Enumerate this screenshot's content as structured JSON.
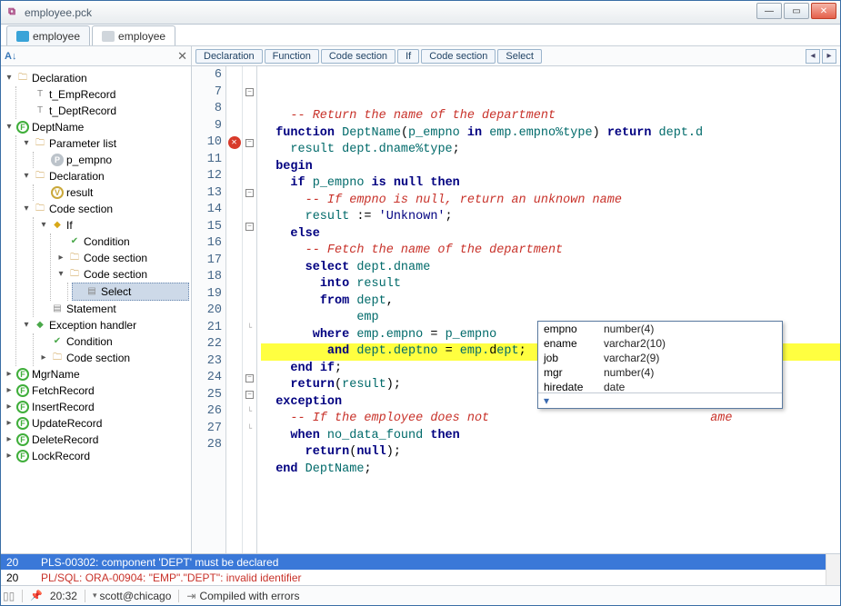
{
  "window": {
    "title": "employee.pck"
  },
  "file_tabs": [
    {
      "label": "employee",
      "active": false,
      "icon": "spec"
    },
    {
      "label": "employee",
      "active": true,
      "icon": "body"
    }
  ],
  "breadcrumbs": [
    "Declaration",
    "Function",
    "Code section",
    "If",
    "Code section",
    "Select"
  ],
  "tree": {
    "decl_label": "Declaration",
    "t_emp": "t_EmpRecord",
    "t_dept": "t_DeptRecord",
    "deptname": "DeptName",
    "paramlist": "Parameter list",
    "p_empno": "p_empno",
    "decl2": "Declaration",
    "result": "result",
    "codesec": "Code section",
    "if": "If",
    "condition": "Condition",
    "codesec2": "Code section",
    "codesec3": "Code section",
    "select": "Select",
    "statement": "Statement",
    "exhandler": "Exception handler",
    "condition2": "Condition",
    "codesec4": "Code section",
    "mgrname": "MgrName",
    "fetchrecord": "FetchRecord",
    "insertrecord": "InsertRecord",
    "updaterecord": "UpdateRecord",
    "deleterecord": "DeleteRecord",
    "lockrecord": "LockRecord"
  },
  "code": {
    "first_line": 6,
    "lines": [
      {
        "n": 6,
        "fold": "",
        "html": "    <span class='cmt'>-- Return the name of the department</span>"
      },
      {
        "n": 7,
        "fold": "box",
        "html": "  <span class='kw'>function</span> <span class='ident'>DeptName</span>(<span class='ident'>p_empno</span> <span class='kw'>in</span> <span class='ident'>emp.empno%type</span>) <span class='kw'>return</span> <span class='ident'>dept.d</span>"
      },
      {
        "n": 8,
        "fold": "",
        "html": "    <span class='ident'>result</span> <span class='ident'>dept.dname%type</span>;"
      },
      {
        "n": 9,
        "fold": "",
        "html": "  <span class='kw'>begin</span>"
      },
      {
        "n": 10,
        "fold": "box",
        "marker": "err",
        "html": "    <span class='kw'>if</span> <span class='ident'>p_empno</span> <span class='kw'>is</span> <span class='kw'>null</span> <span class='kw'>then</span>"
      },
      {
        "n": 11,
        "fold": "",
        "html": "      <span class='cmt'>-- If empno is null, return an unknown name</span>"
      },
      {
        "n": 12,
        "fold": "",
        "html": "      <span class='ident'>result</span> := <span class='str'>'Unknown'</span>;"
      },
      {
        "n": 13,
        "fold": "box",
        "html": "    <span class='kw'>else</span>"
      },
      {
        "n": 14,
        "fold": "",
        "html": "      <span class='cmt'>-- Fetch the name of the department</span>"
      },
      {
        "n": 15,
        "fold": "box",
        "html": "      <span class='kw'>select</span> <span class='ident'>dept.dname</span>"
      },
      {
        "n": 16,
        "fold": "",
        "html": "        <span class='kw'>into</span> <span class='ident'>result</span>"
      },
      {
        "n": 17,
        "fold": "",
        "html": "        <span class='kw'>from</span> <span class='ident'>dept</span>,"
      },
      {
        "n": 18,
        "fold": "",
        "html": "             <span class='ident'>emp</span>"
      },
      {
        "n": 19,
        "fold": "",
        "html": "       <span class='kw'>where</span> <span class='ident'>emp.empno</span> = <span class='ident'>p_empno</span>"
      },
      {
        "n": 20,
        "fold": "",
        "hilite": true,
        "html": "         <span class='kw'>and</span> <span class='ident'>dept.deptno</span> = <span class='ident'>emp.</span><span class='op'>d</span><span class='ident'>ept</span>;"
      },
      {
        "n": 21,
        "fold": "end",
        "html": "    <span class='kw'>end</span> <span class='kw'>if</span>;"
      },
      {
        "n": 22,
        "fold": "",
        "html": "    <span class='kw'>return</span>(<span class='ident'>result</span>);"
      },
      {
        "n": 23,
        "fold": "",
        "html": "  <span class='kw'>exception</span>"
      },
      {
        "n": 24,
        "fold": "box",
        "html": "    <span class='cmt'>-- If the employee does not</span>                              <span class='cmt'>ame</span>"
      },
      {
        "n": 25,
        "fold": "box",
        "html": "    <span class='kw'>when</span> <span class='ident'>no_data_found</span> <span class='kw'>then</span>"
      },
      {
        "n": 26,
        "fold": "end",
        "html": "      <span class='kw'>return</span>(<span class='kw'>null</span>);"
      },
      {
        "n": 27,
        "fold": "end",
        "html": "  <span class='kw'>end</span> <span class='ident'>DeptName</span>;"
      },
      {
        "n": 28,
        "fold": "",
        "html": ""
      }
    ]
  },
  "autocomplete": {
    "items": [
      {
        "name": "empno",
        "type": "number(4)"
      },
      {
        "name": "ename",
        "type": "varchar2(10)"
      },
      {
        "name": "job",
        "type": "varchar2(9)"
      },
      {
        "name": "mgr",
        "type": "number(4)"
      },
      {
        "name": "hiredate",
        "type": "date"
      }
    ],
    "footer_icon": "▾"
  },
  "errors": [
    {
      "line": "20",
      "msg": "PLS-00302: component 'DEPT' must be declared",
      "selected": true
    },
    {
      "line": "20",
      "msg": "PL/SQL: ORA-00904: \"EMP\".\"DEPT\": invalid identifier",
      "selected": false
    }
  ],
  "status": {
    "time": "20:32",
    "user": "scott@chicago",
    "compile": "Compiled with errors"
  }
}
